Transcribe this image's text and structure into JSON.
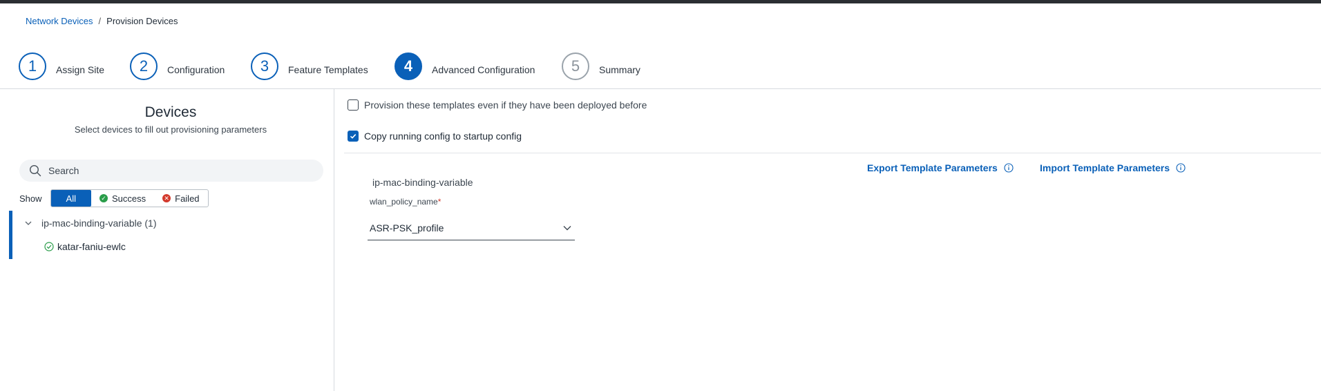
{
  "breadcrumb": {
    "parent": "Network Devices",
    "separator": "/",
    "current": "Provision Devices"
  },
  "steps": [
    {
      "number": "1",
      "label": "Assign Site",
      "state": "done"
    },
    {
      "number": "2",
      "label": "Configuration",
      "state": "done"
    },
    {
      "number": "3",
      "label": "Feature Templates",
      "state": "done"
    },
    {
      "number": "4",
      "label": "Advanced Configuration",
      "state": "active"
    },
    {
      "number": "5",
      "label": "Summary",
      "state": "pending"
    }
  ],
  "left": {
    "title": "Devices",
    "subtitle": "Select devices to fill out provisioning parameters",
    "search_placeholder": "Search",
    "show_label": "Show",
    "filters": {
      "all": "All",
      "success": "Success",
      "failed": "Failed"
    },
    "tree": {
      "group_label": "ip-mac-binding-variable (1)",
      "device": "katar-faniu-ewlc"
    }
  },
  "right": {
    "provision_checkbox_label": "Provision these templates even if they have been deployed before",
    "provision_checked": false,
    "copy_checkbox_label": "Copy running config to startup config",
    "copy_checked": true,
    "export_label": "Export Template Parameters",
    "import_label": "Import Template Parameters",
    "template_name": "ip-mac-binding-variable",
    "field_label": "wlan_policy_name",
    "required_marker": "*",
    "field_value": "ASR-PSK_profile"
  },
  "colors": {
    "accent": "#0a60b8",
    "success": "#2a9d4a",
    "error": "#d33a2c"
  }
}
